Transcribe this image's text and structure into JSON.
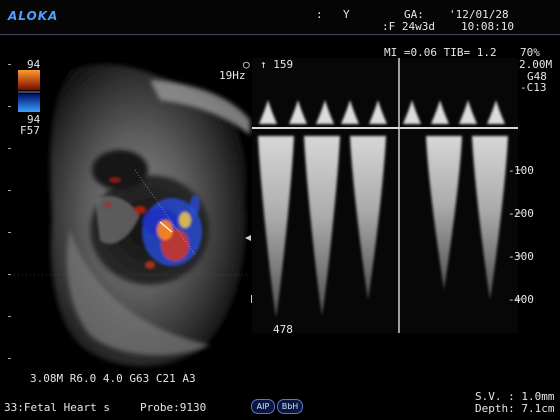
{
  "header": {
    "brand": "ALOKA",
    "field_colon": ":",
    "field_y": "Y",
    "ga_label": "GA:",
    "date": "'12/01/28",
    "ga_value": ":F 24w3d",
    "time": "10:08:10"
  },
  "readouts": {
    "mi_tib": "MI =0.06 TIB= 1.2",
    "power": "70%",
    "freq_doppler": "2.00M",
    "gain": "G48",
    "contrast": "-C13",
    "prf": "19Hz",
    "velocity_scale": "↑ 159",
    "bottom_velocity": "478",
    "color_top": "94",
    "color_bottom": "94",
    "color_filter": "F57",
    "bmode_params": "3.08M R6.0 4.0 G63 C21 A3",
    "sv": "S.V. : 1.0mm",
    "depth": "Depth: 7.1cm"
  },
  "doppler_scale": {
    "labels": [
      "100",
      "200",
      "300",
      "400"
    ]
  },
  "footer": {
    "preset": "33:Fetal Heart s",
    "probe": "Probe:9130",
    "aip_button": "AIP",
    "bbh_button": "BbH"
  },
  "colors": {
    "brand_blue": "#4aa0ff",
    "color_flow_red": "#d2371e",
    "color_flow_blue": "#2850e6",
    "text": "#e6e6e6"
  }
}
